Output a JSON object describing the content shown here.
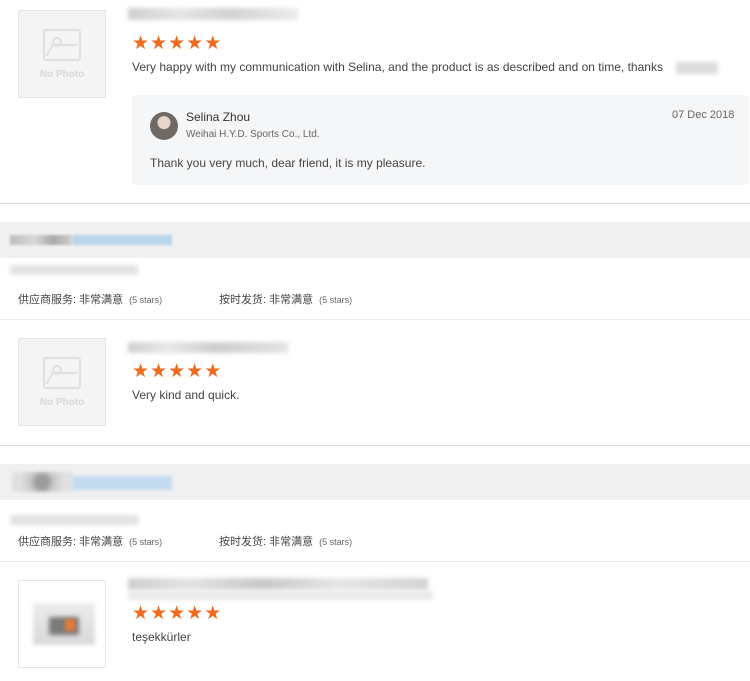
{
  "reviews": [
    {
      "placeholder_label": "No Photo",
      "rating": 5,
      "comment": "Very happy with my communication with Selina, and the product is as described and on time, thanks",
      "reply": {
        "author": "Selina Zhou",
        "company": "Weihai H.Y.D. Sports Co., Ltd.",
        "date": "07 Dec 2018",
        "text": "Thank you very much, dear friend, it is my pleasure."
      }
    },
    {
      "placeholder_label": "No Photo",
      "rating": 5,
      "comment": "Very kind and quick."
    },
    {
      "rating": 5,
      "comment": "teşekkürler"
    }
  ],
  "buyer_ratings": [
    {
      "supplier_service_label": "供应商服务: 非常满意",
      "supplier_service_stars": "(5 stars)",
      "ontime_label": "按时发货: 非常满意",
      "ontime_stars": "(5 stars)"
    },
    {
      "supplier_service_label": "供应商服务: 非常满意",
      "supplier_service_stars": "(5 stars)",
      "ontime_label": "按时发货: 非常满意",
      "ontime_stars": "(5 stars)"
    }
  ],
  "colors": {
    "star": "#f26b1d",
    "band": "#f0f0f0",
    "reply_bg": "#f5f6f8"
  }
}
